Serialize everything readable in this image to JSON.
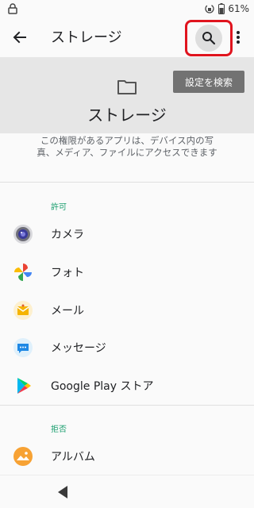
{
  "status_bar": {
    "battery_text": "61%"
  },
  "app_bar": {
    "title": "ストレージ"
  },
  "header": {
    "settings_search_label": "設定を検索",
    "heading": "ストレージ"
  },
  "description": "この権限があるアプリは、デバイス内の写真、メディア、ファイルにアクセスできます",
  "allowed_section": {
    "label": "許可",
    "apps": [
      {
        "name": "カメラ",
        "icon": "camera-icon"
      },
      {
        "name": "フォト",
        "icon": "photos-icon"
      },
      {
        "name": "メール",
        "icon": "mail-icon"
      },
      {
        "name": "メッセージ",
        "icon": "messages-icon"
      },
      {
        "name": "Google Play ストア",
        "icon": "play-store-icon"
      }
    ]
  },
  "denied_section": {
    "label": "拒否",
    "apps": [
      {
        "name": "アルバム",
        "icon": "album-icon"
      }
    ]
  },
  "colors": {
    "accent_green": "#1a9e6e",
    "highlight_red": "#e0141e",
    "header_band": "#e6e6e6"
  }
}
